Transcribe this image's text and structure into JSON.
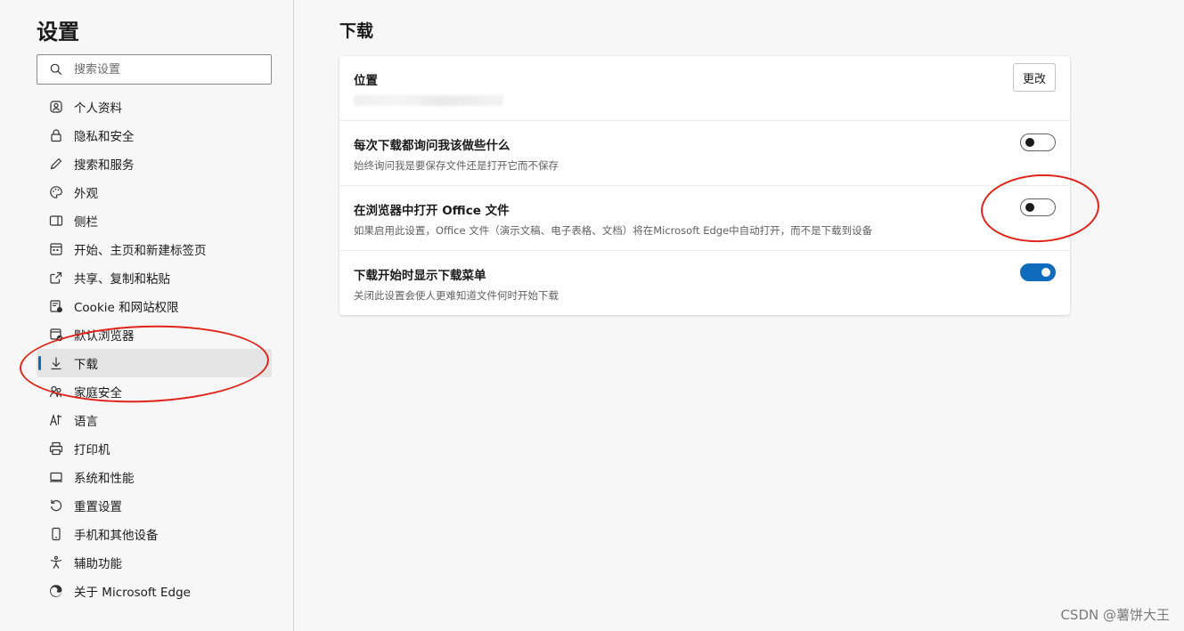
{
  "sidebar": {
    "title": "设置",
    "search_placeholder": "搜索设置",
    "items": [
      {
        "label": "个人资料",
        "icon": "profile-icon"
      },
      {
        "label": "隐私和安全",
        "icon": "lock-icon"
      },
      {
        "label": "搜索和服务",
        "icon": "pencil-icon"
      },
      {
        "label": "外观",
        "icon": "palette-icon"
      },
      {
        "label": "侧栏",
        "icon": "sidebar-icon"
      },
      {
        "label": "开始、主页和新建标签页",
        "icon": "home-icon"
      },
      {
        "label": "共享、复制和粘贴",
        "icon": "share-icon"
      },
      {
        "label": "Cookie 和网站权限",
        "icon": "cookie-icon"
      },
      {
        "label": "默认浏览器",
        "icon": "browser-icon"
      },
      {
        "label": "下载",
        "icon": "download-icon",
        "active": true
      },
      {
        "label": "家庭安全",
        "icon": "family-icon"
      },
      {
        "label": "语言",
        "icon": "language-icon"
      },
      {
        "label": "打印机",
        "icon": "printer-icon"
      },
      {
        "label": "系统和性能",
        "icon": "system-icon"
      },
      {
        "label": "重置设置",
        "icon": "reset-icon"
      },
      {
        "label": "手机和其他设备",
        "icon": "phone-icon"
      },
      {
        "label": "辅助功能",
        "icon": "accessibility-icon"
      },
      {
        "label": "关于 Microsoft Edge",
        "icon": "edge-icon"
      }
    ]
  },
  "main": {
    "title": "下载",
    "location": {
      "title": "位置",
      "change_label": "更改"
    },
    "ask_each_time": {
      "title": "每次下载都询问我该做些什么",
      "desc": "始终询问我是要保存文件还是打开它而不保存",
      "enabled": false
    },
    "open_office": {
      "title": "在浏览器中打开 Office 文件",
      "desc": "如果启用此设置，Office 文件（演示文稿、电子表格、文档）将在Microsoft Edge中自动打开，而不是下载到设备",
      "enabled": false
    },
    "show_menu": {
      "title": "下载开始时显示下载菜单",
      "desc": "关闭此设置会使人更难知道文件何时开始下载",
      "enabled": true
    }
  },
  "colors": {
    "accent": "#0f6cbd",
    "annotation": "#e0241b"
  },
  "watermark": "CSDN @薯饼大王"
}
